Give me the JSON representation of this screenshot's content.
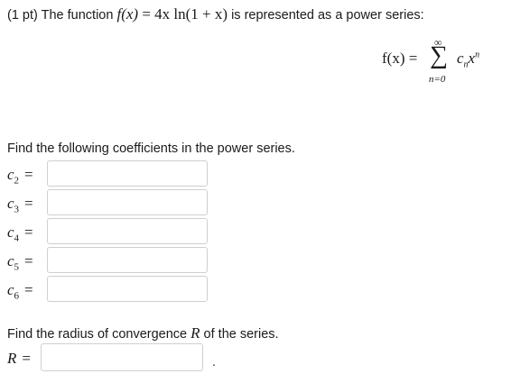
{
  "problem": {
    "points": "(1 pt)",
    "intro": "The function",
    "function_lhs": "f(x)",
    "function_rhs": "= 4x ln(1 + x)",
    "suffix": "is represented as a power series:"
  },
  "series": {
    "lhs": "f(x) =",
    "upper": "∞",
    "lower": "n=0",
    "coef_symbol": "c",
    "coef_sub": "n",
    "var": "x",
    "var_exp": "n"
  },
  "coefficients_prompt": "Find the following coefficients in the power series.",
  "coefficients": [
    {
      "symbol": "c",
      "index": "2",
      "eq": "=",
      "value": ""
    },
    {
      "symbol": "c",
      "index": "3",
      "eq": "=",
      "value": ""
    },
    {
      "symbol": "c",
      "index": "4",
      "eq": "=",
      "value": ""
    },
    {
      "symbol": "c",
      "index": "5",
      "eq": "=",
      "value": ""
    },
    {
      "symbol": "c",
      "index": "6",
      "eq": "=",
      "value": ""
    }
  ],
  "radius_prompt": {
    "before": "Find the radius of convergence",
    "symbol": "R",
    "after": "of the series."
  },
  "radius": {
    "symbol": "R",
    "eq": "=",
    "value": "",
    "trailing": "."
  }
}
